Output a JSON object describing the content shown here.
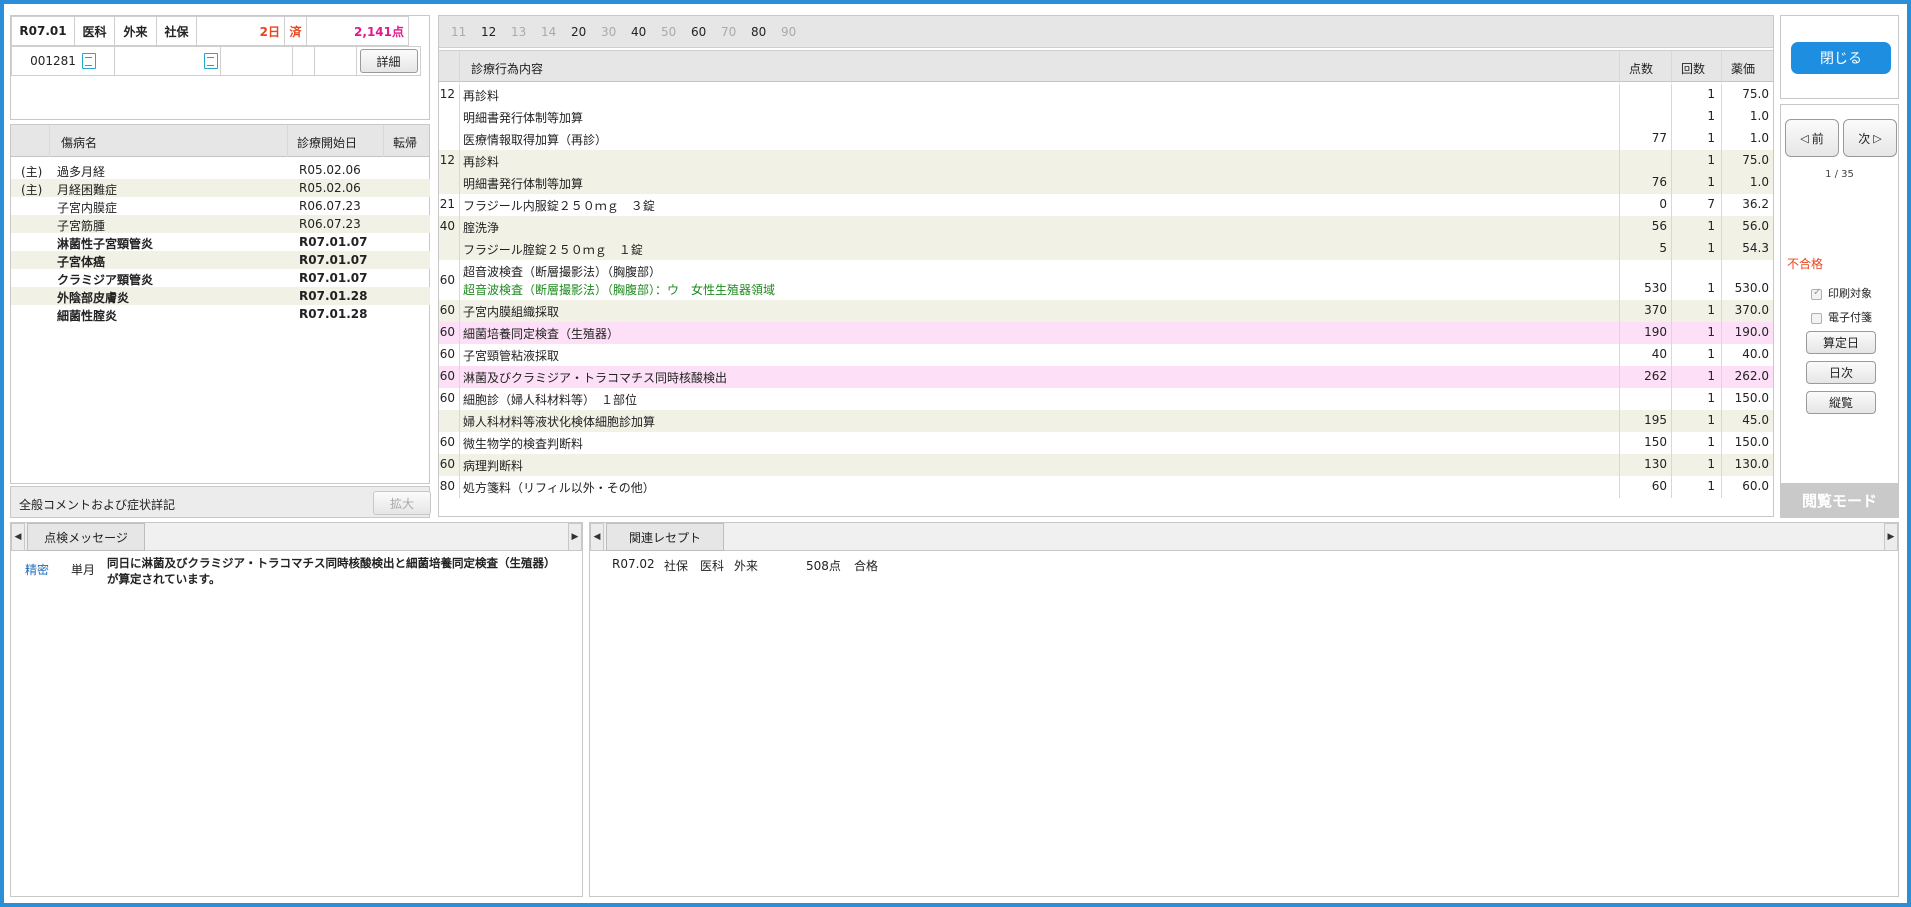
{
  "patient": {
    "era_month": "R07.01",
    "dept": "医科",
    "visit_type": "外来",
    "insurance": "社保",
    "days": "2日",
    "status": "済",
    "points": "2,141点",
    "patient_id": "001281",
    "detail_button": "詳細"
  },
  "diseases": {
    "headers": {
      "name": "傷病名",
      "start": "診療開始日",
      "outcome": "転帰"
    },
    "rows": [
      {
        "main": "(主)",
        "name": "過多月経",
        "start": "R05.02.06",
        "outcome": "",
        "bold": false
      },
      {
        "main": "(主)",
        "name": "月経困難症",
        "start": "R05.02.06",
        "outcome": "",
        "bold": false
      },
      {
        "main": "",
        "name": "子宮内膜症",
        "start": "R06.07.23",
        "outcome": "",
        "bold": false
      },
      {
        "main": "",
        "name": "子宮筋腫",
        "start": "R06.07.23",
        "outcome": "",
        "bold": false
      },
      {
        "main": "",
        "name": "淋菌性子宮頸管炎",
        "start": "R07.01.07",
        "outcome": "",
        "bold": true
      },
      {
        "main": "",
        "name": "子宮体癌",
        "start": "R07.01.07",
        "outcome": "",
        "bold": true
      },
      {
        "main": "",
        "name": "クラミジア頸管炎",
        "start": "R07.01.07",
        "outcome": "",
        "bold": true
      },
      {
        "main": "",
        "name": "外陰部皮膚炎",
        "start": "R07.01.28",
        "outcome": "",
        "bold": true
      },
      {
        "main": "",
        "name": "細菌性腟炎",
        "start": "R07.01.28",
        "outcome": "",
        "bold": true
      }
    ],
    "comment_label": "全般コメントおよび症状詳記",
    "expand_button": "拡大"
  },
  "category_tabs": [
    {
      "label": "11",
      "active": false
    },
    {
      "label": "12",
      "active": true
    },
    {
      "label": "13",
      "active": false
    },
    {
      "label": "14",
      "active": false
    },
    {
      "label": "20",
      "active": true
    },
    {
      "label": "30",
      "active": false
    },
    {
      "label": "40",
      "active": true
    },
    {
      "label": "50",
      "active": false
    },
    {
      "label": "60",
      "active": true
    },
    {
      "label": "70",
      "active": false
    },
    {
      "label": "80",
      "active": true
    },
    {
      "label": "90",
      "active": false
    }
  ],
  "treatments": {
    "headers": {
      "name": "診療行為内容",
      "points": "点数",
      "count": "回数",
      "price": "薬価"
    },
    "rows": [
      {
        "code": "12",
        "name": "再診料",
        "name2": "",
        "points": "",
        "count": "1",
        "price": "75.0",
        "bg": "white"
      },
      {
        "code": "",
        "name": "明細書発行体制等加算",
        "name2": "",
        "points": "",
        "count": "1",
        "price": "1.0",
        "bg": "white"
      },
      {
        "code": "",
        "name": "医療情報取得加算（再診）",
        "name2": "",
        "points": "77",
        "count": "1",
        "price": "1.0",
        "bg": "white"
      },
      {
        "code": "12",
        "name": "再診料",
        "name2": "",
        "points": "",
        "count": "1",
        "price": "75.0",
        "bg": "alt"
      },
      {
        "code": "",
        "name": "明細書発行体制等加算",
        "name2": "",
        "points": "76",
        "count": "1",
        "price": "1.0",
        "bg": "alt"
      },
      {
        "code": "21",
        "name": "フラジール内服錠２５０ｍｇ　３錠",
        "name2": "",
        "points": "0",
        "count": "7",
        "price": "36.2",
        "bg": "white"
      },
      {
        "code": "40",
        "name": "腟洗浄",
        "name2": "",
        "points": "56",
        "count": "1",
        "price": "56.0",
        "bg": "alt"
      },
      {
        "code": "",
        "name": "フラジール腟錠２５０ｍｇ　１錠",
        "name2": "",
        "points": "5",
        "count": "1",
        "price": "54.3",
        "bg": "alt"
      },
      {
        "code": "60",
        "name": "超音波検査（断層撮影法）（胸腹部）",
        "name2": "超音波検査（断層撮影法）（胸腹部）：ウ　女性生殖器領域",
        "points": "530",
        "count": "1",
        "price": "530.0",
        "bg": "white"
      },
      {
        "code": "60",
        "name": "子宮内膜組織採取",
        "name2": "",
        "points": "370",
        "count": "1",
        "price": "370.0",
        "bg": "alt"
      },
      {
        "code": "60",
        "name": "細菌培養同定検査（生殖器）",
        "name2": "",
        "points": "190",
        "count": "1",
        "price": "190.0",
        "bg": "pink"
      },
      {
        "code": "60",
        "name": "子宮頸管粘液採取",
        "name2": "",
        "points": "40",
        "count": "1",
        "price": "40.0",
        "bg": "white"
      },
      {
        "code": "60",
        "name": "淋菌及びクラミジア・トラコマチス同時核酸検出",
        "name2": "",
        "points": "262",
        "count": "1",
        "price": "262.0",
        "bg": "pink"
      },
      {
        "code": "60",
        "name": "細胞診（婦人科材料等）　１部位",
        "name2": "",
        "points": "",
        "count": "1",
        "price": "150.0",
        "bg": "white"
      },
      {
        "code": "",
        "name": "婦人科材料等液状化検体細胞診加算",
        "name2": "",
        "points": "195",
        "count": "1",
        "price": "45.0",
        "bg": "alt"
      },
      {
        "code": "60",
        "name": "微生物学的検査判断料",
        "name2": "",
        "points": "150",
        "count": "1",
        "price": "150.0",
        "bg": "white"
      },
      {
        "code": "60",
        "name": "病理判断料",
        "name2": "",
        "points": "130",
        "count": "1",
        "price": "130.0",
        "bg": "alt"
      },
      {
        "code": "80",
        "name": "処方箋料（リフィル以外・その他）",
        "name2": "",
        "points": "60",
        "count": "1",
        "price": "60.0",
        "bg": "white"
      }
    ]
  },
  "right": {
    "close_button": "閉じる",
    "prev_button": "前",
    "next_button": "次",
    "page": "1 / 35",
    "result": "不合格",
    "print_target": "印刷対象",
    "e_attach": "電子付箋",
    "calc_day_button": "算定日",
    "daily_button": "日次",
    "vertical_button": "縦覧",
    "view_mode": "閲覧モード"
  },
  "check_messages": {
    "tab": "点検メッセージ",
    "items": [
      {
        "type": "精密",
        "period": "単月",
        "line1": "同日に淋菌及びクラミジア・トラコマチス同時核酸検出と細菌培養同定検査（生殖器）",
        "line2": "が算定されています。"
      }
    ]
  },
  "related": {
    "tab": "関連レセプト",
    "items": [
      {
        "month": "R07.02",
        "insurance": "社保",
        "dept": "医科",
        "visit": "外来",
        "points": "508点",
        "result": "合格"
      }
    ]
  },
  "colors": {
    "accent": "#1e8fe0",
    "frame": "#2a8fd6",
    "pink_row": "#fde0f7",
    "alt_row": "#f1f1e6",
    "fail": "#e8451e",
    "points": "#e0198c"
  }
}
